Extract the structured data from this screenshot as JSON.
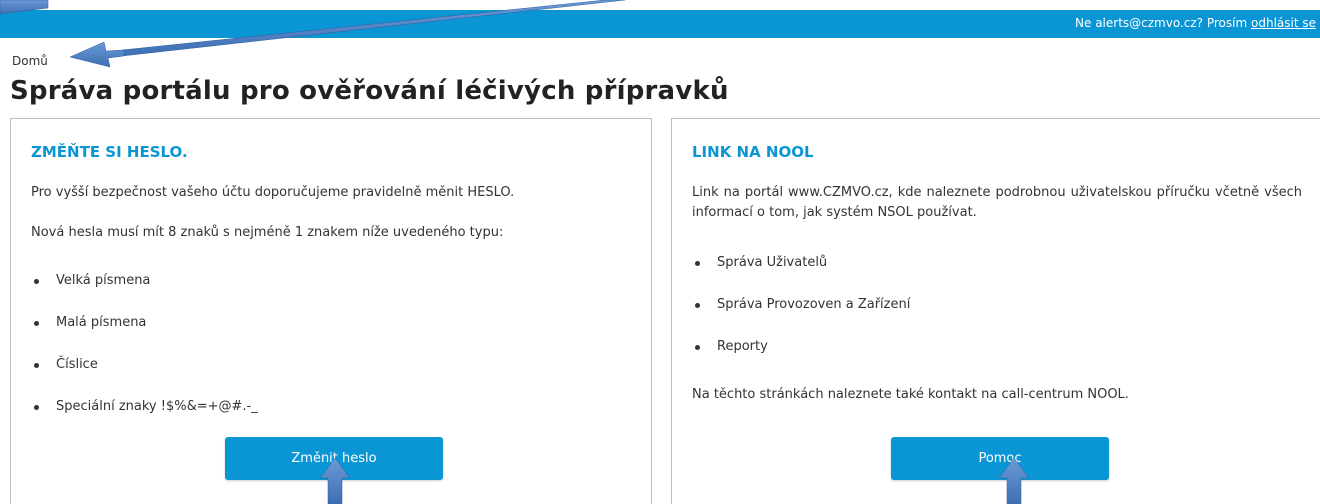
{
  "header": {
    "user_prefix": "Ne alerts@czmvo.cz?  Prosím ",
    "logout_link": "odhlásit se"
  },
  "breadcrumb": "Domů",
  "title": "Správa portálu pro ověřování léčivých přípravků",
  "left_panel": {
    "heading": "ZMĚŇTE SI HESLO.",
    "p1": "Pro vyšší bezpečnost vašeho účtu doporučujeme pravidelně měnit HESLO.",
    "p2": "Nová hesla musí mít 8 znaků s nejméně 1 znakem níže uvedeného typu:",
    "items": [
      "Velká písmena",
      "Malá písmena",
      "Číslice",
      "Speciální znaky !$%&=+@#.-_"
    ],
    "button": "Změnit heslo"
  },
  "right_panel": {
    "heading": "LINK NA NOOL",
    "p1": "Link na portál www.CZMVO.cz, kde naleznete podrobnou uživatelskou příručku včetně všech informací o tom, jak systém NSOL používat.",
    "items": [
      "Správa Uživatelů",
      "Správa Provozoven a Zařízení",
      "Reporty"
    ],
    "p2": "Na těchto stránkách naleznete také kontakt na call-centrum NOOL.",
    "button": "Pomoc"
  },
  "colors": {
    "accent": "#0a96d4",
    "arrow": "#4a7fc1"
  }
}
